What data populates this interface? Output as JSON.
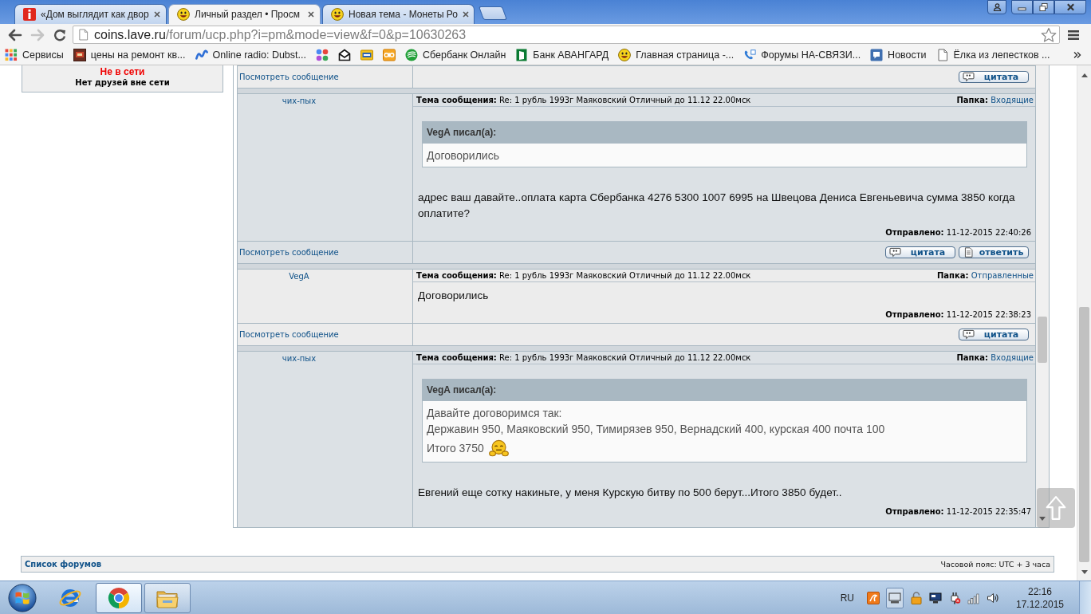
{
  "browser": {
    "tabs": [
      {
        "title": "«Дом выглядит как двор",
        "selected": false,
        "kind": "alert"
      },
      {
        "title": "Личный раздел • Просм",
        "selected": true,
        "kind": "smiley"
      },
      {
        "title": "Новая тема - Монеты Ро",
        "selected": false,
        "kind": "smiley"
      }
    ],
    "address": {
      "host": "coins.lave.ru",
      "path": "/forum/ucp.php?i=pm&mode=view&f=0&p=10630263"
    },
    "bookmarks": [
      {
        "label": "Сервисы",
        "kind": "apps"
      },
      {
        "label": "цены на ремонт кв...",
        "kind": "image"
      },
      {
        "label": "Online radio: Dubst...",
        "kind": "radio"
      },
      {
        "kind": "dots"
      },
      {
        "kind": "mail"
      },
      {
        "kind": "tnt"
      },
      {
        "kind": "ctc"
      },
      {
        "label": "Сбербанк Онлайн",
        "kind": "sber"
      },
      {
        "label": "Банк АВАНГАРД",
        "kind": "avangard"
      },
      {
        "label": "Главная страница -...",
        "kind": "smiley"
      },
      {
        "label": "Форумы НА-СВЯЗИ...",
        "kind": "phone"
      },
      {
        "label": "Новости",
        "kind": "chat"
      },
      {
        "label": "Ёлка из лепестков ...",
        "kind": "page"
      }
    ]
  },
  "sidebar": {
    "status": "Не в сети",
    "note": "Нет друзей вне сети"
  },
  "messages": [
    {
      "footer": {
        "link": "Посмотреть сообщение",
        "buttons": [
          {
            "label": "цитата",
            "kind": "quote"
          }
        ]
      }
    },
    {
      "author": "чих-пых",
      "subject_label": "Тема сообщения:",
      "subject": "Re: 1 рубль 1993г Маяковский Отличный до 11.12 22.00мск",
      "folder_label": "Папка:",
      "folder": "Входящие",
      "quote": {
        "header": "VegA писал(а):",
        "lines": [
          "Договорились"
        ]
      },
      "text": "адрес ваш давайте..оплата карта Сбербанка 4276 5300 1007 6995 на Швецова Дениса Евгеньевича сумма 3850 когда оплатите?",
      "sent_label": "Отправлено:",
      "sent": "11-12-2015 22:40:26",
      "footer": {
        "link": "Посмотреть сообщение",
        "buttons": [
          {
            "label": "цитата",
            "kind": "quote"
          },
          {
            "label": "ответить",
            "kind": "reply"
          }
        ]
      }
    },
    {
      "author": "VegA",
      "subject_label": "Тема сообщения:",
      "subject": "Re: 1 рубль 1993г Маяковский Отличный до 11.12 22.00мск",
      "folder_label": "Папка:",
      "folder": "Отправленные",
      "text": "Договорились",
      "sent_label": "Отправлено:",
      "sent": "11-12-2015 22:38:23",
      "footer": {
        "link": "Посмотреть сообщение",
        "buttons": [
          {
            "label": "цитата",
            "kind": "quote"
          }
        ]
      }
    },
    {
      "author": "чих-пых",
      "subject_label": "Тема сообщения:",
      "subject": "Re: 1 рубль 1993г Маяковский Отличный до 11.12 22.00мск",
      "folder_label": "Папка:",
      "folder": "Входящие",
      "quote": {
        "header": "VegA писал(а):",
        "lines": [
          "Давайте договоримся так:",
          "Державин 950, Маяковский 950, Тимирязев 950, Вернадский 400, курская 400 почта 100",
          "Итого 3750"
        ],
        "emoticon": true
      },
      "text": "Евгений еще сотку накиньте, у меня Курскую битву по 500 берут...Итого 3850 будет..",
      "sent_label": "Отправлено:",
      "sent": "11-12-2015 22:35:47"
    }
  ],
  "forum_nav": {
    "link": "Список форумов",
    "timezone": "Часовой пояс: UTC + 3 часа"
  },
  "taskbar": {
    "apps": [
      {
        "kind": "ie",
        "running": false,
        "selected": false
      },
      {
        "kind": "chrome",
        "running": true,
        "selected": true
      },
      {
        "kind": "explorer",
        "running": true,
        "selected": false
      }
    ],
    "language": "RU",
    "time": "22:16",
    "date": "17.12.2015"
  }
}
